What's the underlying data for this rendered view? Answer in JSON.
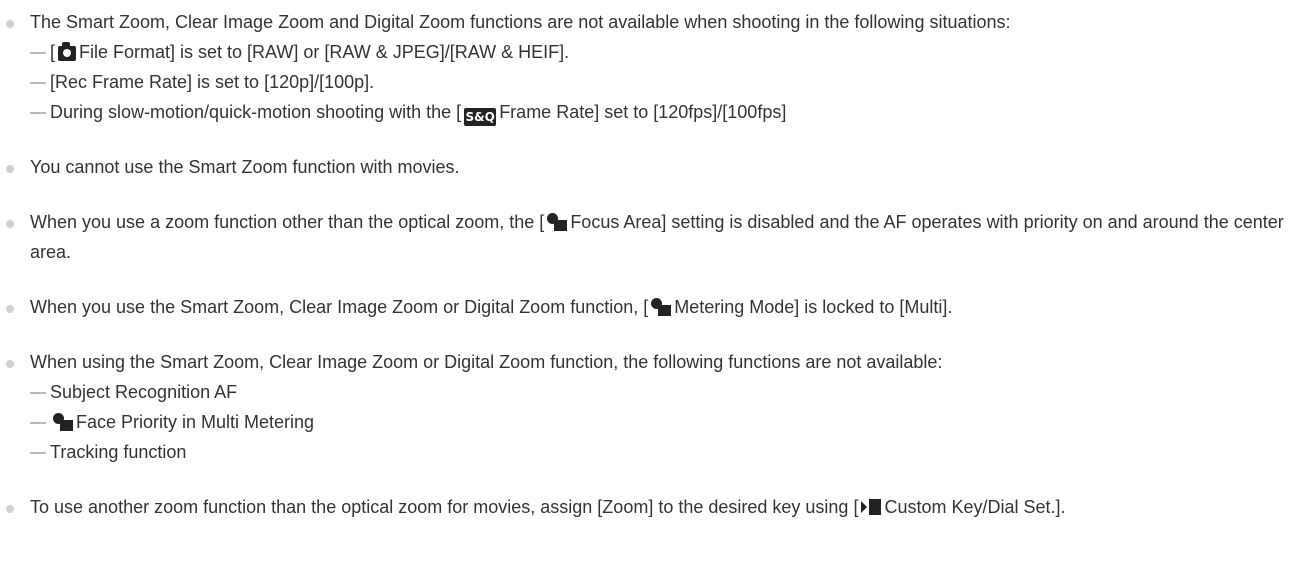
{
  "notes": [
    {
      "before": "The Smart Zoom, Clear Image Zoom and Digital Zoom functions are not available when shooting in the following situations:",
      "sub": [
        {
          "pre": "[",
          "icon": "camera-icon",
          "post": "File Format] is set to [RAW] or [RAW & JPEG]/[RAW & HEIF]."
        },
        {
          "text": "[Rec Frame Rate] is set to [120p]/[100p]."
        },
        {
          "pre": "During slow-motion/quick-motion shooting with the [",
          "icon": "sq-icon",
          "icon_text": "S&Q",
          "post": "Frame Rate] set to [120fps]/[100fps]"
        }
      ]
    },
    {
      "text": "You cannot use the Smart Zoom function with movies."
    },
    {
      "pre": "When you use a zoom function other than the optical zoom, the [",
      "icon": "photo-movie-icon",
      "post": "Focus Area] setting is disabled and the AF operates with priority on and around the center area."
    },
    {
      "pre": "When you use the Smart Zoom, Clear Image Zoom or Digital Zoom function, [",
      "icon": "photo-movie-icon",
      "post": "Metering Mode] is locked to [Multi]."
    },
    {
      "before": "When using the Smart Zoom, Clear Image Zoom or Digital Zoom function, the following functions are not available:",
      "sub": [
        {
          "text": "Subject Recognition AF"
        },
        {
          "icon": "photo-movie-icon",
          "post": "Face Priority in Multi Metering"
        },
        {
          "text": "Tracking function"
        }
      ]
    },
    {
      "pre": "To use another zoom function than the optical zoom for movies, assign [Zoom] to the desired key using [",
      "icon": "movie-icon",
      "post": "Custom Key/Dial Set.]."
    }
  ]
}
